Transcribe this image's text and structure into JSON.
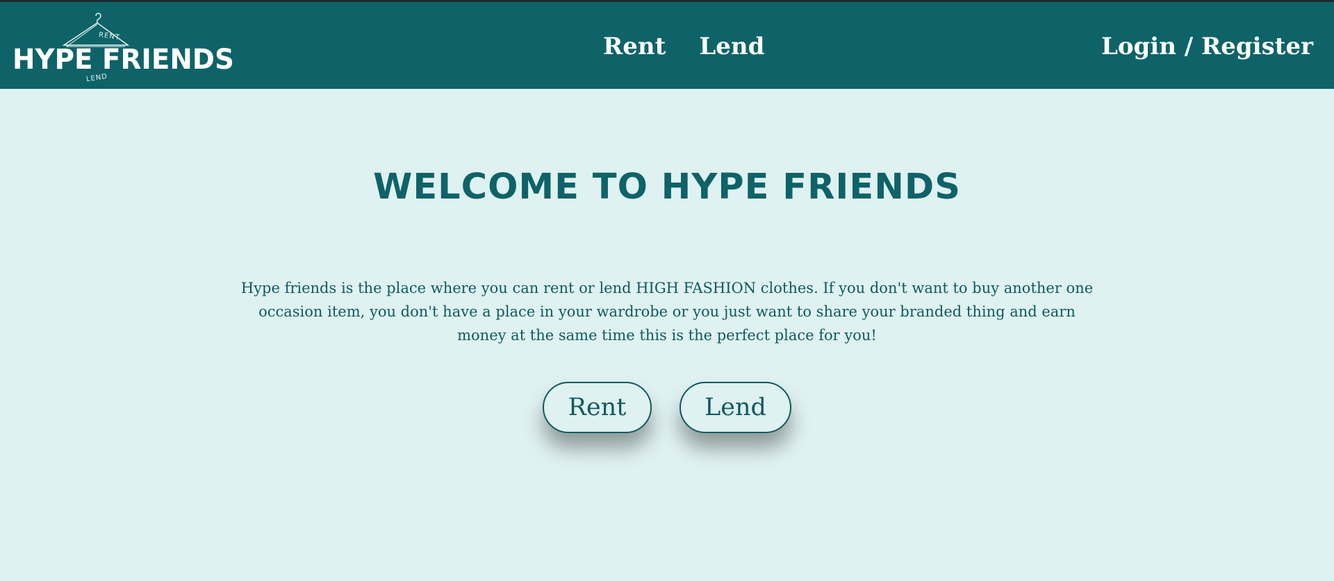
{
  "brand": {
    "name": "HYPE FRIENDS",
    "tag_top": "RENT",
    "tag_bottom": "LEND"
  },
  "nav": {
    "links": [
      {
        "label": "Rent"
      },
      {
        "label": "Lend"
      }
    ],
    "login_label": "Login / Register"
  },
  "hero": {
    "title": "WELCOME TO HYPE FRIENDS",
    "description": "Hype friends is the place where you can rent or lend HIGH FASHION clothes. If you don't want to buy another one occasion item, you don't have a place in your wardrobe or you just want to share your branded thing and earn money at the same time this is the perfect place for you!",
    "buttons": [
      {
        "label": "Rent"
      },
      {
        "label": "Lend"
      }
    ]
  },
  "colors": {
    "navbar": "#0e6368",
    "hero_background": "#dff1f1",
    "accent_text": "#0e5a5f"
  },
  "icons": {
    "logo": "hanger-icon"
  }
}
